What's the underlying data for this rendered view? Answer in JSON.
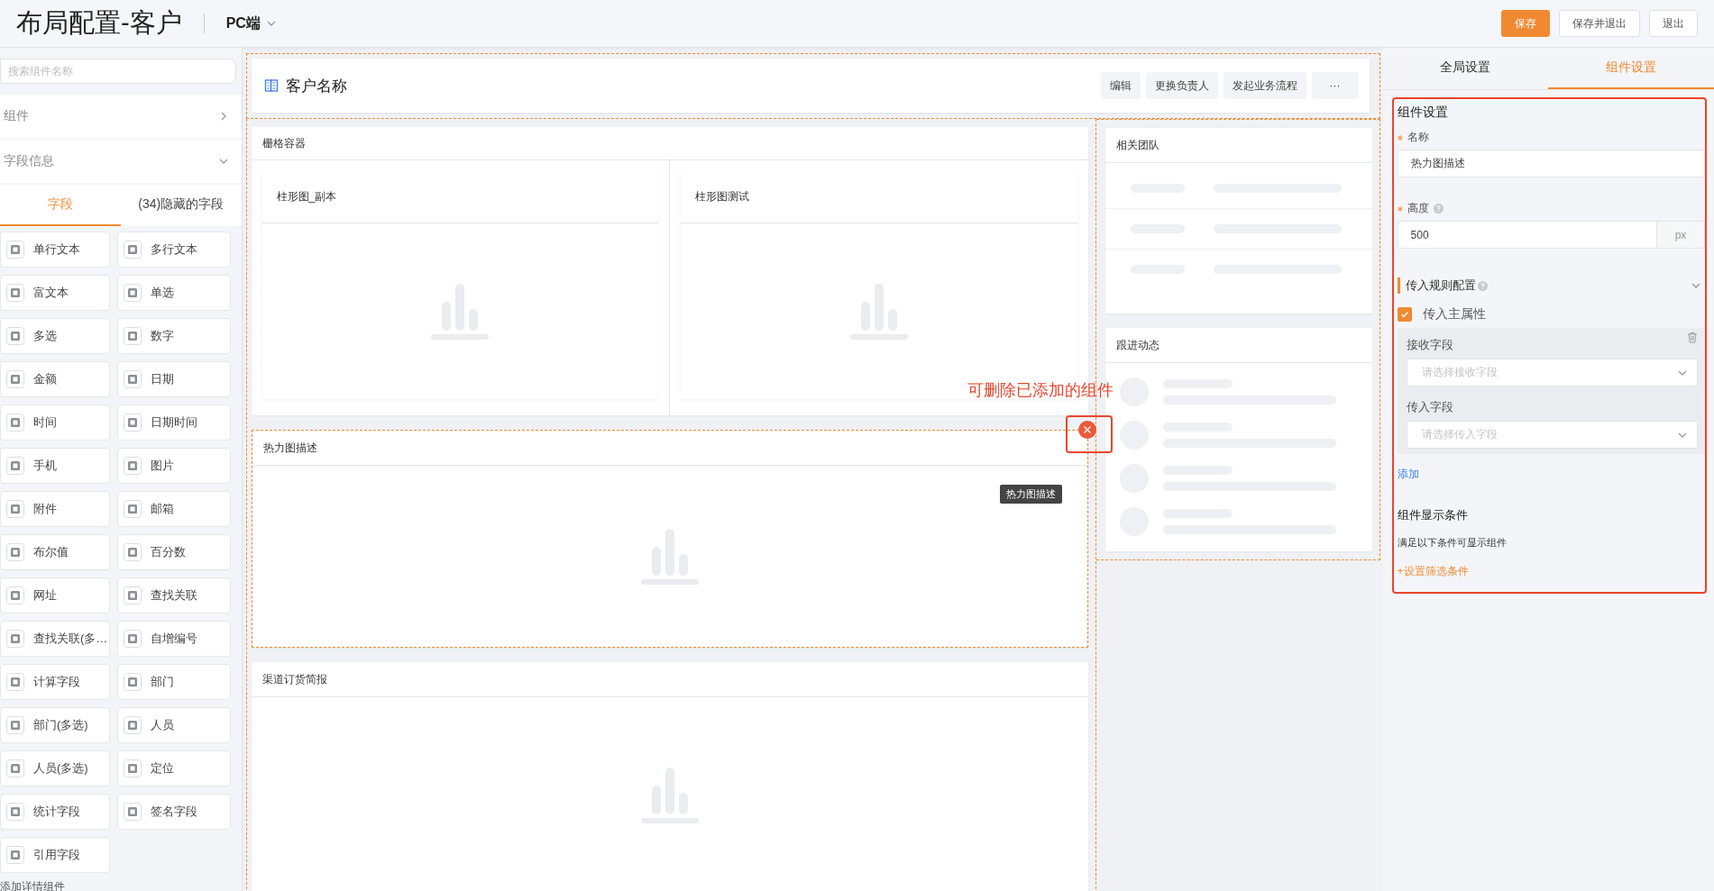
{
  "header": {
    "title": "布局配置-客户",
    "platform": "PC端",
    "buttons": [
      {
        "label": "保存",
        "kind": "primary"
      },
      {
        "label": "保存并退出",
        "kind": "default"
      },
      {
        "label": "退出",
        "kind": "default"
      }
    ]
  },
  "sidebar": {
    "search": {
      "placeholder": "搜索组件名称"
    },
    "sections": [
      {
        "label": "组件",
        "expanded": false
      },
      {
        "label": "字段信息",
        "expanded": true
      }
    ],
    "tabs": [
      {
        "label": "字段",
        "selected": true
      },
      {
        "label": "(34)隐藏的字段",
        "selected": false
      }
    ],
    "fields": [
      "单行文本",
      "多行文本",
      "富文本",
      "单选",
      "多选",
      "数字",
      "金额",
      "日期",
      "时间",
      "日期时间",
      "手机",
      "图片",
      "附件",
      "邮箱",
      "布尔值",
      "百分数",
      "网址",
      "查找关联",
      "查找关联(多…",
      "自增编号",
      "计算字段",
      "部门",
      "部门(多选)",
      "人员",
      "人员(多选)",
      "定位",
      "统计字段",
      "签名字段",
      "引用字段"
    ],
    "footer": "添加详情组件"
  },
  "canvas": {
    "record_card": {
      "title": "客户名称",
      "actions": [
        "编辑",
        "更换负责人",
        "发起业务流程",
        "···"
      ]
    },
    "grid_container": {
      "title": "栅格容器",
      "charts": [
        "柱形图_副本",
        "柱形图测试"
      ]
    },
    "heatmap": {
      "title": "热力图描述",
      "tooltip": "热力图描述",
      "selected": true
    },
    "annotation": "可删除已添加的组件",
    "report": {
      "title": "渠道订货简报"
    },
    "team": {
      "title": "相关团队"
    },
    "activity": {
      "title": "跟进动态"
    }
  },
  "settings": {
    "tabs": [
      {
        "label": "全局设置",
        "selected": false
      },
      {
        "label": "组件设置",
        "selected": true
      }
    ],
    "title": "组件设置",
    "name": {
      "label": "名称",
      "value": "热力图描述"
    },
    "height": {
      "label": "高度",
      "value": "500",
      "unit": "px"
    },
    "rule_section": {
      "title": "传入规则配置",
      "expanded": true
    },
    "main_attr": {
      "label": "传入主属性",
      "checked": true
    },
    "receive": {
      "label": "接收字段",
      "placeholder": "请选择接收字段"
    },
    "pass": {
      "label": "传入字段",
      "placeholder": "请选择传入字段"
    },
    "add_link": "添加",
    "condition_title": "组件显示条件",
    "condition_text": "满足以下条件可显示组件",
    "condition_link": "+设置筛选条件"
  }
}
